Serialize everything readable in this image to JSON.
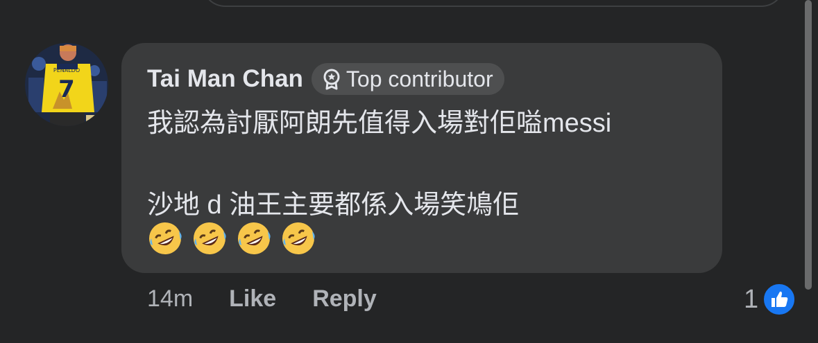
{
  "comment": {
    "author": "Tai Man Chan",
    "badge": {
      "label": "Top contributor",
      "icon": "top-contributor-icon"
    },
    "text_lines": [
      "我認為討厭阿朗先值得入場對佢嗌messi",
      "沙地 d 油王主要都係入場笑鳩佢"
    ],
    "emojis": [
      "rolling-on-floor-laughing",
      "rolling-on-floor-laughing",
      "rolling-on-floor-laughing",
      "rolling-on-floor-laughing"
    ],
    "time": "14m",
    "like_label": "Like",
    "reply_label": "Reply",
    "reaction_count": "1",
    "reaction_type": "like-reaction-icon"
  },
  "colors": {
    "background": "#242526",
    "bubble": "#3a3b3c",
    "text": "#e4e6eb",
    "secondary_text": "#b0b3b8",
    "like_blue": "#1877f2"
  }
}
